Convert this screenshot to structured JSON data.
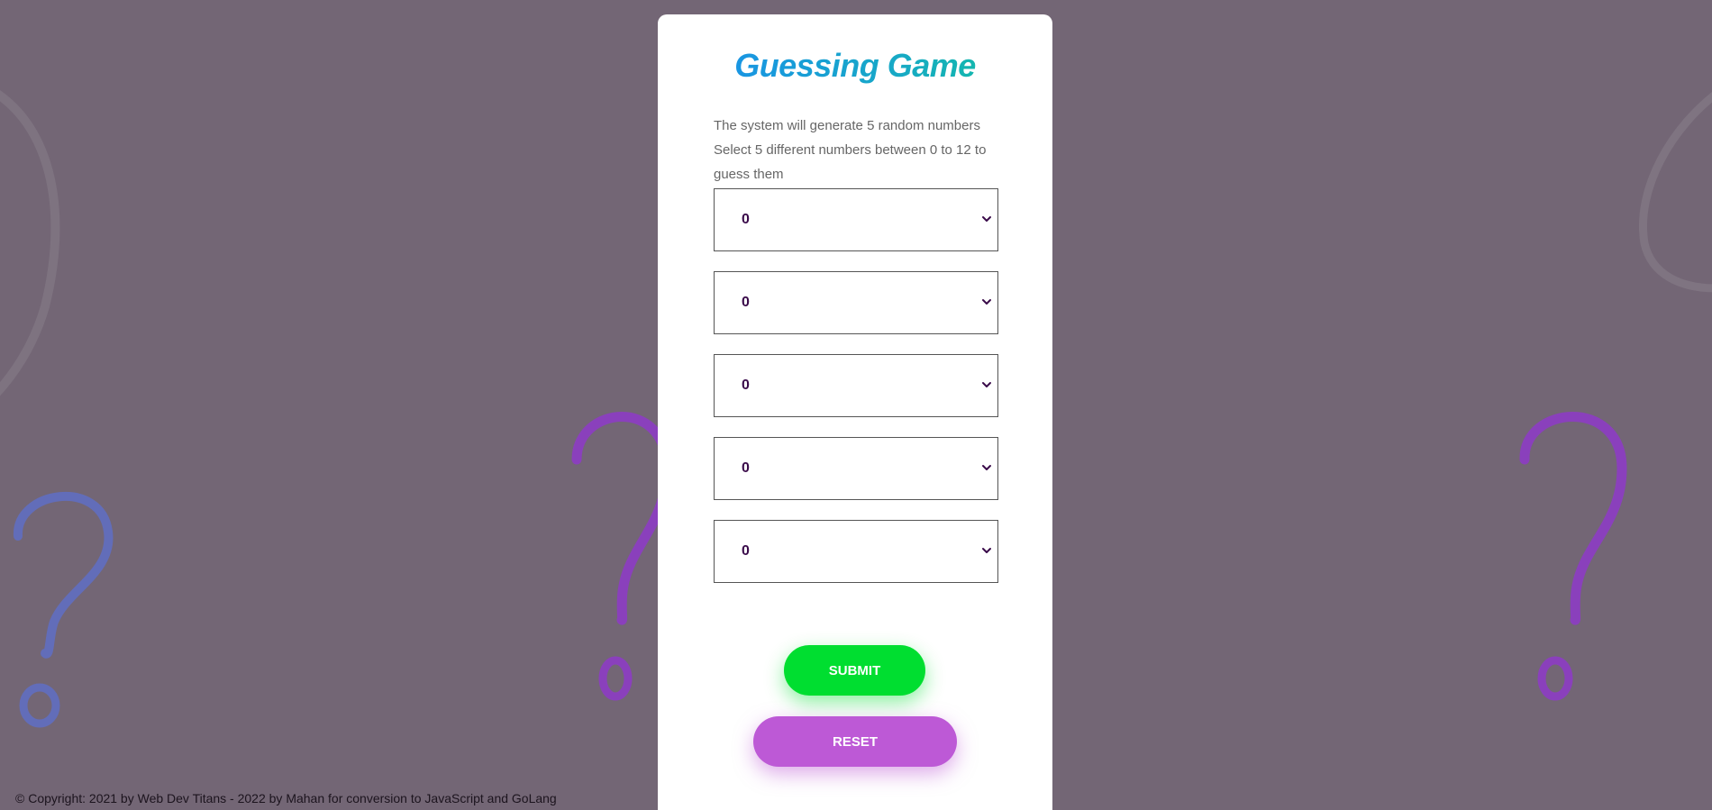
{
  "app": {
    "title": "Guessing Game"
  },
  "intro": {
    "line1": "The system will generate 5 random numbers",
    "line2": "Select 5 different numbers between 0 to 12 to guess them"
  },
  "selects": [
    {
      "value": "0"
    },
    {
      "value": "0"
    },
    {
      "value": "0"
    },
    {
      "value": "0"
    },
    {
      "value": "0"
    }
  ],
  "icons": {
    "dropdown": "chevron-down-icon",
    "background": "question-mark-icon"
  },
  "buttons": {
    "submit_label": "SUBMIT",
    "reset_label": "RESET"
  },
  "footer": {
    "copyright": "© Copyright: 2021 by Web Dev Titans - 2022 by Mahan for conversion to JavaScript and GoLang"
  },
  "colors": {
    "background": "#736675",
    "card": "#ffffff",
    "submit": "#00de30",
    "reset": "#bd59d6",
    "title_gradient_start": "#1a8cf0",
    "title_gradient_end": "#10c29a"
  }
}
